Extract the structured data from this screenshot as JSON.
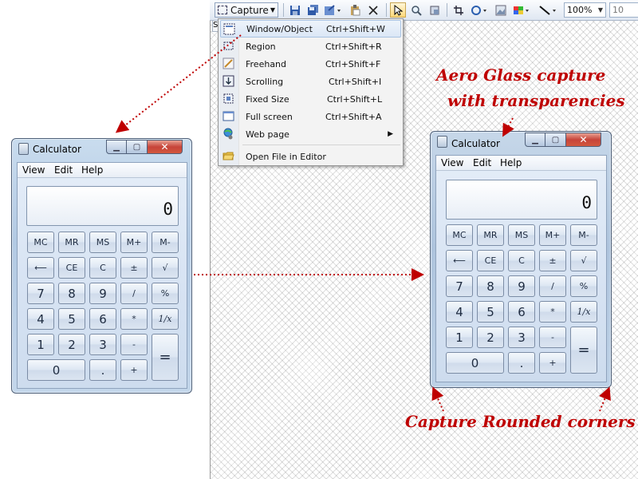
{
  "toolbar": {
    "capture_label": "Capture",
    "zoom_value": "100%",
    "size_value": "10",
    "tab_stub": "S"
  },
  "capture_menu": {
    "items": [
      {
        "label": "Window/Object",
        "shortcut": "Ctrl+Shift+W",
        "icon": "window-object-icon"
      },
      {
        "label": "Region",
        "shortcut": "Ctrl+Shift+R",
        "icon": "region-icon"
      },
      {
        "label": "Freehand",
        "shortcut": "Ctrl+Shift+F",
        "icon": "freehand-icon"
      },
      {
        "label": "Scrolling",
        "shortcut": "Ctrl+Shift+I",
        "icon": "scrolling-icon"
      },
      {
        "label": "Fixed Size",
        "shortcut": "Ctrl+Shift+L",
        "icon": "fixed-size-icon"
      },
      {
        "label": "Full screen",
        "shortcut": "Ctrl+Shift+A",
        "icon": "full-screen-icon"
      },
      {
        "label": "Web page",
        "shortcut": "",
        "icon": "web-page-icon",
        "submenu": true
      },
      {
        "label": "Open File in Editor",
        "shortcut": "",
        "icon": "folder-icon"
      }
    ],
    "highlighted": "Window/Object"
  },
  "calculator": {
    "title": "Calculator",
    "menu": [
      "View",
      "Edit",
      "Help"
    ],
    "display": "0",
    "keys": [
      [
        "MC",
        "MR",
        "MS",
        "M+",
        "M-"
      ],
      [
        "⟵",
        "CE",
        "C",
        "±",
        "√"
      ],
      [
        "7",
        "8",
        "9",
        "/",
        "%"
      ],
      [
        "4",
        "5",
        "6",
        "*",
        "1/x"
      ],
      [
        "1",
        "2",
        "3",
        "-",
        "="
      ],
      [
        "0",
        ".",
        "+"
      ]
    ]
  },
  "annotations": {
    "aero_line1": "Aero Glass capture",
    "aero_line2": "with transparencies",
    "rounded": "Capture Rounded corners"
  },
  "colors": {
    "annotation": "#bf0000",
    "menu_highlight": "#dbe7f6"
  }
}
